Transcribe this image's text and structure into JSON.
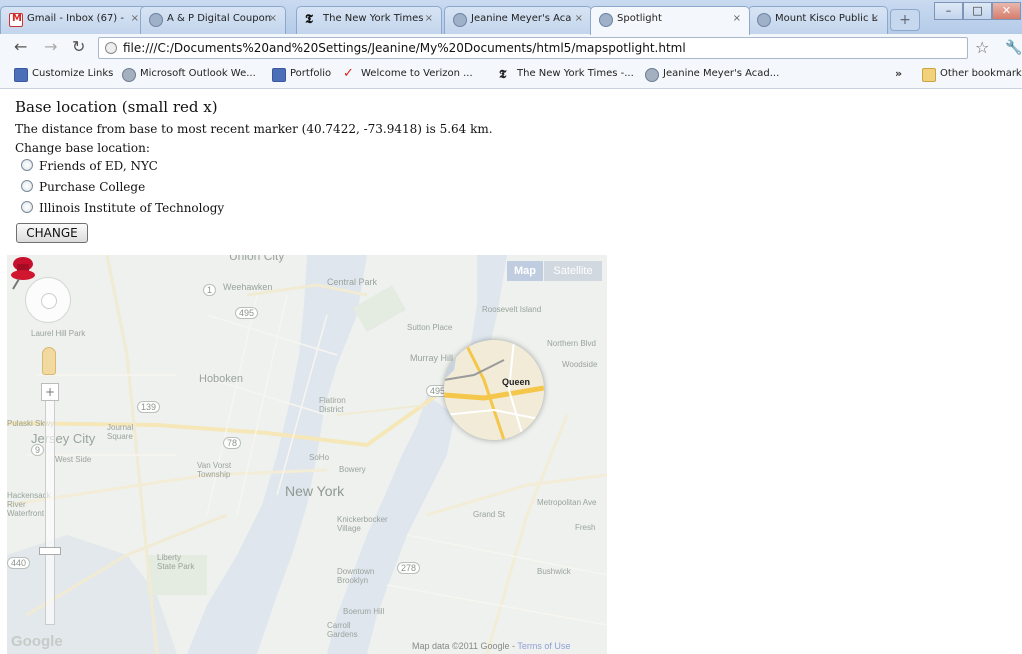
{
  "browser": {
    "tabs": [
      {
        "label": "Gmail - Inbox (67) -",
        "icon": "gmail-icon"
      },
      {
        "label": "A & P Digital Coupon",
        "icon": "globe-icon"
      },
      {
        "label": "The New York Times",
        "icon": "nyt-icon"
      },
      {
        "label": "Jeanine Meyer's Aca",
        "icon": "globe-icon"
      },
      {
        "label": "Spotlight",
        "icon": "globe-icon",
        "active": true
      },
      {
        "label": "Mount Kisco Public L",
        "icon": "globe-icon"
      }
    ],
    "address": "file:///C:/Documents%20and%20Settings/Jeanine/My%20Documents/html5/mapspotlight.html",
    "bookmarks": [
      {
        "label": "Customize Links",
        "icon": "windows-live-icon"
      },
      {
        "label": "Microsoft Outlook We...",
        "icon": "globe-icon"
      },
      {
        "label": "Portfolio",
        "icon": "portfolio-icon"
      },
      {
        "label": "Welcome to Verizon ...",
        "icon": "verizon-icon"
      },
      {
        "label": "The New York Times -...",
        "icon": "nyt-icon"
      },
      {
        "label": "Jeanine Meyer's Acad...",
        "icon": "globe-icon"
      }
    ],
    "more_bookmarks": "»",
    "other_bookmarks": "Other bookmarks"
  },
  "page": {
    "heading": "Base location (small red x)",
    "distance_text": "The distance from base to most recent marker (40.7422, -73.9418) is 5.64 km.",
    "change_label": "Change base location:",
    "options": [
      "Friends of ED, NYC",
      "Purchase College",
      "Illinois Institute of Technology"
    ],
    "change_button": "CHANGE"
  },
  "map": {
    "type_buttons": {
      "map": "Map",
      "satellite": "Satellite"
    },
    "labels": {
      "union_city": "Union City",
      "weehawken": "Weehawken",
      "central_park": "Central Park",
      "roosevelt_island": "Roosevelt Island",
      "sutton_place": "Sutton Place",
      "laurel_hill_park": "Laurel Hill Park",
      "murray_hill": "Murray Hill",
      "northern_blvd": "Northern Blvd",
      "woodside": "Woodside",
      "hoboken": "Hoboken",
      "flatiron": "Flatiron District",
      "pulaski": "Pulaski Skwy",
      "jersey_city": "Jersey City",
      "journal_square": "Journal Square",
      "west_side": "West Side",
      "van_vorst": "Van Vorst Township",
      "soho": "SoHo",
      "bowery": "Bowery",
      "new_york": "New York",
      "hackensack": "Hackensack River Waterfront",
      "knickerbocker": "Knickerbocker Village",
      "grand_st": "Grand St",
      "metropolitan_ave": "Metropolitan Ave",
      "fresh": "Fresh",
      "liberty": "Liberty State Park",
      "downtown_brooklyn": "Downtown Brooklyn",
      "bushwick": "Bushwick",
      "boerum_hill": "Boerum Hill",
      "carroll_gardens": "Carroll Gardens",
      "queens": "Queen"
    },
    "route_shields": [
      "1",
      "495",
      "139",
      "9",
      "78",
      "278",
      "440",
      "495"
    ],
    "attribution": "Map data ©2011 Google -",
    "terms": "Terms of Use",
    "logo": "Google"
  }
}
